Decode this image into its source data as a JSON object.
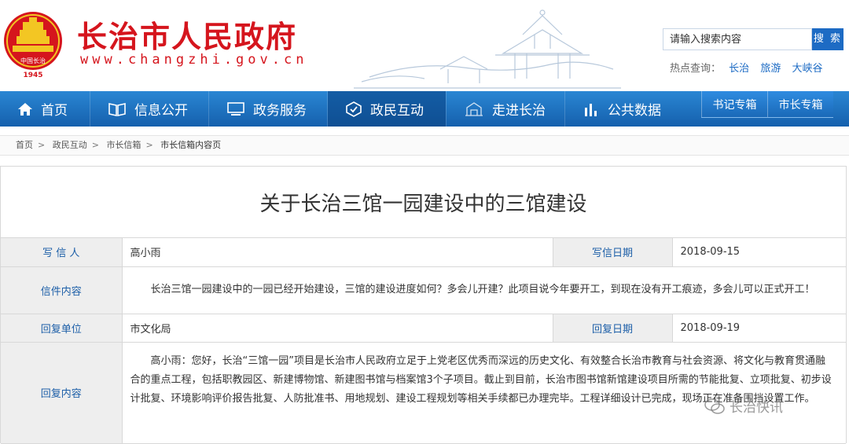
{
  "header": {
    "site_title": "长治市人民政府",
    "site_url": "www.changzhi.gov.cn",
    "emblem": {
      "icon": "city-emblem-icon",
      "text": "中国长治",
      "year": "1945"
    },
    "brand_color": "#d5151d"
  },
  "search": {
    "placeholder": "请输入搜索内容",
    "button_label": "搜 索",
    "hot_label": "热点查询：",
    "hot_links": [
      "长治",
      "旅游",
      "大峡谷"
    ]
  },
  "nav": {
    "items": [
      {
        "label": "首页",
        "icon": "home-icon"
      },
      {
        "label": "信息公开",
        "icon": "book-icon"
      },
      {
        "label": "政务服务",
        "icon": "monitor-icon"
      },
      {
        "label": "政民互动",
        "icon": "interaction-icon",
        "active": true
      },
      {
        "label": "走进长治",
        "icon": "building-icon"
      },
      {
        "label": "公共数据",
        "icon": "bar-chart-icon"
      }
    ],
    "special_tabs": [
      "书记专箱",
      "市长专箱"
    ],
    "color": "#1d6bc4"
  },
  "breadcrumb": [
    "首页",
    "政民互动",
    "市长信箱",
    "市长信箱内容页"
  ],
  "letter": {
    "title": "关于长治三馆一园建设中的三馆建设",
    "writer_label": "写 信 人",
    "writer": "高小雨",
    "write_date_label": "写信日期",
    "write_date": "2018-09-15",
    "content_label": "信件内容",
    "content": "长治三馆一园建设中的一园已经开始建设，三馆的建设进度如何？多会儿开建？此项目说今年要开工，到现在没有开工痕迹，多会儿可以正式开工！",
    "reply_unit_label": "回复单位",
    "reply_unit": "市文化局",
    "reply_date_label": "回复日期",
    "reply_date": "2018-09-19",
    "reply_label": "回复内容",
    "reply": "高小雨：您好，长治“三馆一园”项目是长治市人民政府立足于上党老区优秀而深远的历史文化、有效整合长治市教育与社会资源、将文化与教育贯通融合的重点工程，包括职教园区、新建博物馆、新建图书馆与档案馆3个子项目。截止到目前，长治市图书馆新馆建设项目所需的节能批复、立项批复、初步设计批复、环境影响评价报告批复、人防批准书、用地规划、建设工程规划等相关手续都已办理完毕。工程详细设计已完成，现场正在准备围挡设置工作。"
  },
  "watermark": {
    "text": "长治快讯",
    "icon": "wechat-icon"
  }
}
